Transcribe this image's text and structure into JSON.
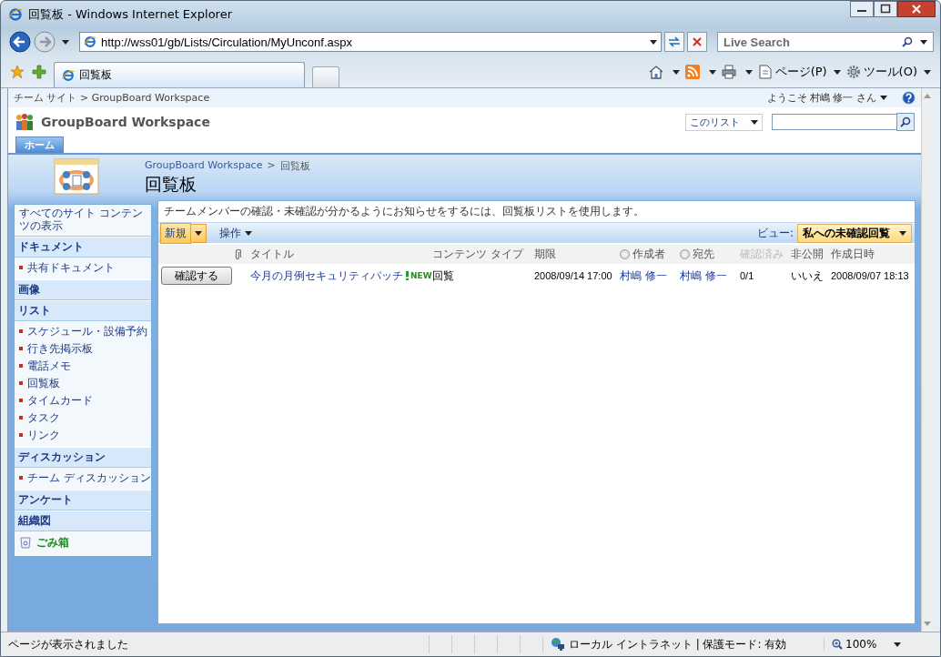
{
  "window": {
    "title": "回覧板 - Windows Internet Explorer"
  },
  "nav": {
    "address": "http://wss01/gb/Lists/Circulation/MyUnconf.aspx",
    "search_placeholder": "Live Search"
  },
  "browser_tab": {
    "title": "回覧板"
  },
  "command_bar": [
    "ページ(P)",
    "ツール(O)"
  ],
  "site": {
    "breadcrumb": "チーム サイト > GroupBoard Workspace",
    "welcome": "ようこそ 村嶋 修一 さん",
    "search_scope": "このリスト",
    "logo_title": "GroupBoard Workspace"
  },
  "top_nav": [
    {
      "label": "ホーム",
      "selected": true
    }
  ],
  "page": {
    "breadcrumb": [
      "GroupBoard Workspace",
      "回覧板"
    ],
    "separator": ">",
    "title": "回覧板",
    "description": "チームメンバーの確認・未確認が分かるようにお知らせをするには、回覧板リストを使用します。"
  },
  "sidebar": {
    "all_content": "すべてのサイト コンテンツの表示",
    "sections": [
      {
        "heading": "ドキュメント",
        "items": [
          "共有ドキュメント"
        ]
      },
      {
        "heading": "画像"
      },
      {
        "heading": "リスト",
        "items": [
          "スケジュール・設備予約",
          "行き先掲示板",
          "電話メモ",
          "回覧板",
          "タイムカード",
          "タスク",
          "リンク"
        ]
      },
      {
        "heading": "ディスカッション",
        "items": [
          "チーム ディスカッション"
        ]
      },
      {
        "heading": "アンケート"
      },
      {
        "heading": "組織図"
      }
    ],
    "recycle_bin": "ごみ箱"
  },
  "toolbar": {
    "new": "新規",
    "actions": "操作",
    "view_label": "ビュー:",
    "view": "私への未確認回覧"
  },
  "columns": [
    {
      "kind": "attachment"
    },
    {
      "kind": "text",
      "label": "タイトル",
      "dimmed": false
    },
    {
      "kind": "text",
      "label": "コンテンツ タイプ",
      "dimmed": false
    },
    {
      "kind": "text",
      "label": "期限",
      "dimmed": false
    },
    {
      "kind": "radio",
      "label": "作成者",
      "dimmed": false,
      "checked": false
    },
    {
      "kind": "radio",
      "label": "宛先",
      "dimmed": false,
      "checked": false
    },
    {
      "kind": "text",
      "label": "確認済み",
      "dimmed": true
    },
    {
      "kind": "text",
      "label": "非公開",
      "dimmed": false
    },
    {
      "kind": "text",
      "label": "作成日時",
      "dimmed": false
    }
  ],
  "rows": [
    {
      "button": "確認する",
      "title": "今月の月例セキュリティパッチ",
      "new_badge": "NEW",
      "content_type": "回覧",
      "due": "2008/09/14 17:00",
      "author": "村嶋 修一",
      "recipient": "村嶋 修一",
      "confirmed": "0/1",
      "private": "いいえ",
      "created": "2008/09/07 18:13"
    }
  ],
  "status_bar": {
    "text": "ページが表示されました",
    "zone": "ローカル イントラネット | 保護モード: 有効",
    "zoom": "100%"
  }
}
